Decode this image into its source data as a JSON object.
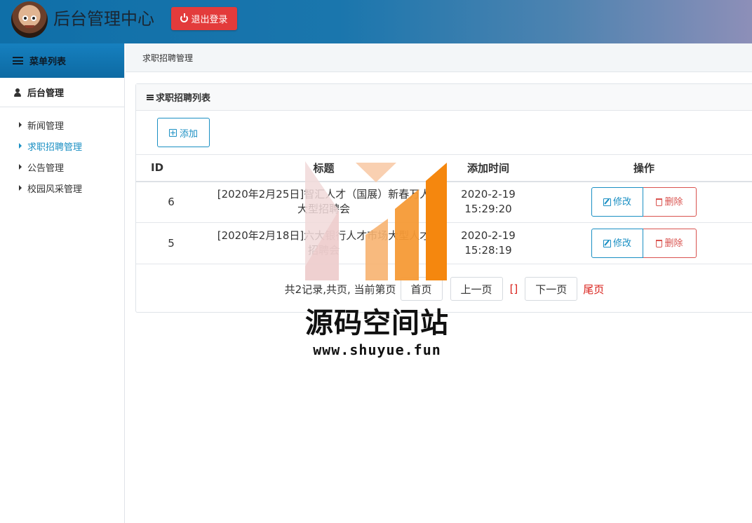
{
  "header": {
    "title": "后台管理中心",
    "logout_label": "退出登录",
    "colors": {
      "gradient_start": "#0f6fa8",
      "gradient_end": "#8d8fb8",
      "logout_bg": "#e33b3b"
    }
  },
  "sidebar": {
    "menu_title": "菜单列表",
    "group_title": "后台管理",
    "items": [
      {
        "label": "新闻管理",
        "active": false
      },
      {
        "label": "求职招聘管理",
        "active": true
      },
      {
        "label": "公告管理",
        "active": false
      },
      {
        "label": "校园风采管理",
        "active": false
      }
    ],
    "icons": {
      "menu": "list-icon",
      "group": "user-icon",
      "item": "caret-right-icon"
    }
  },
  "breadcrumb": {
    "current": "求职招聘管理"
  },
  "panel": {
    "heading": "求职招聘列表",
    "add_label": "添加"
  },
  "table": {
    "columns": [
      "ID",
      "标题",
      "添加时间",
      "操作"
    ],
    "rows": [
      {
        "id": "6",
        "title": "[2020年2月25日]智汇人才（国展）新春万人大型招聘会",
        "time_date": "2020-2-19",
        "time_clock": "15:29:20",
        "edit_label": "修改",
        "delete_label": "删除"
      },
      {
        "id": "5",
        "title": "[2020年2月18日]六大银行人才市场大型人才招聘会",
        "time_date": "2020-2-19",
        "time_clock": "15:28:19",
        "edit_label": "修改",
        "delete_label": "删除"
      }
    ]
  },
  "pager": {
    "summary": "共2记录,共页, 当前第页",
    "first": "首页",
    "prev": "上一页",
    "current": "[]",
    "next": "下一页",
    "last": "尾页"
  },
  "watermark": {
    "name": "源码空间站",
    "url": "www.shuyue.fun",
    "colors": {
      "pink": "#f1d9d9",
      "peach": "#f8cba8",
      "orange": "#f7b370",
      "deep_orange": "#f5870e"
    }
  }
}
